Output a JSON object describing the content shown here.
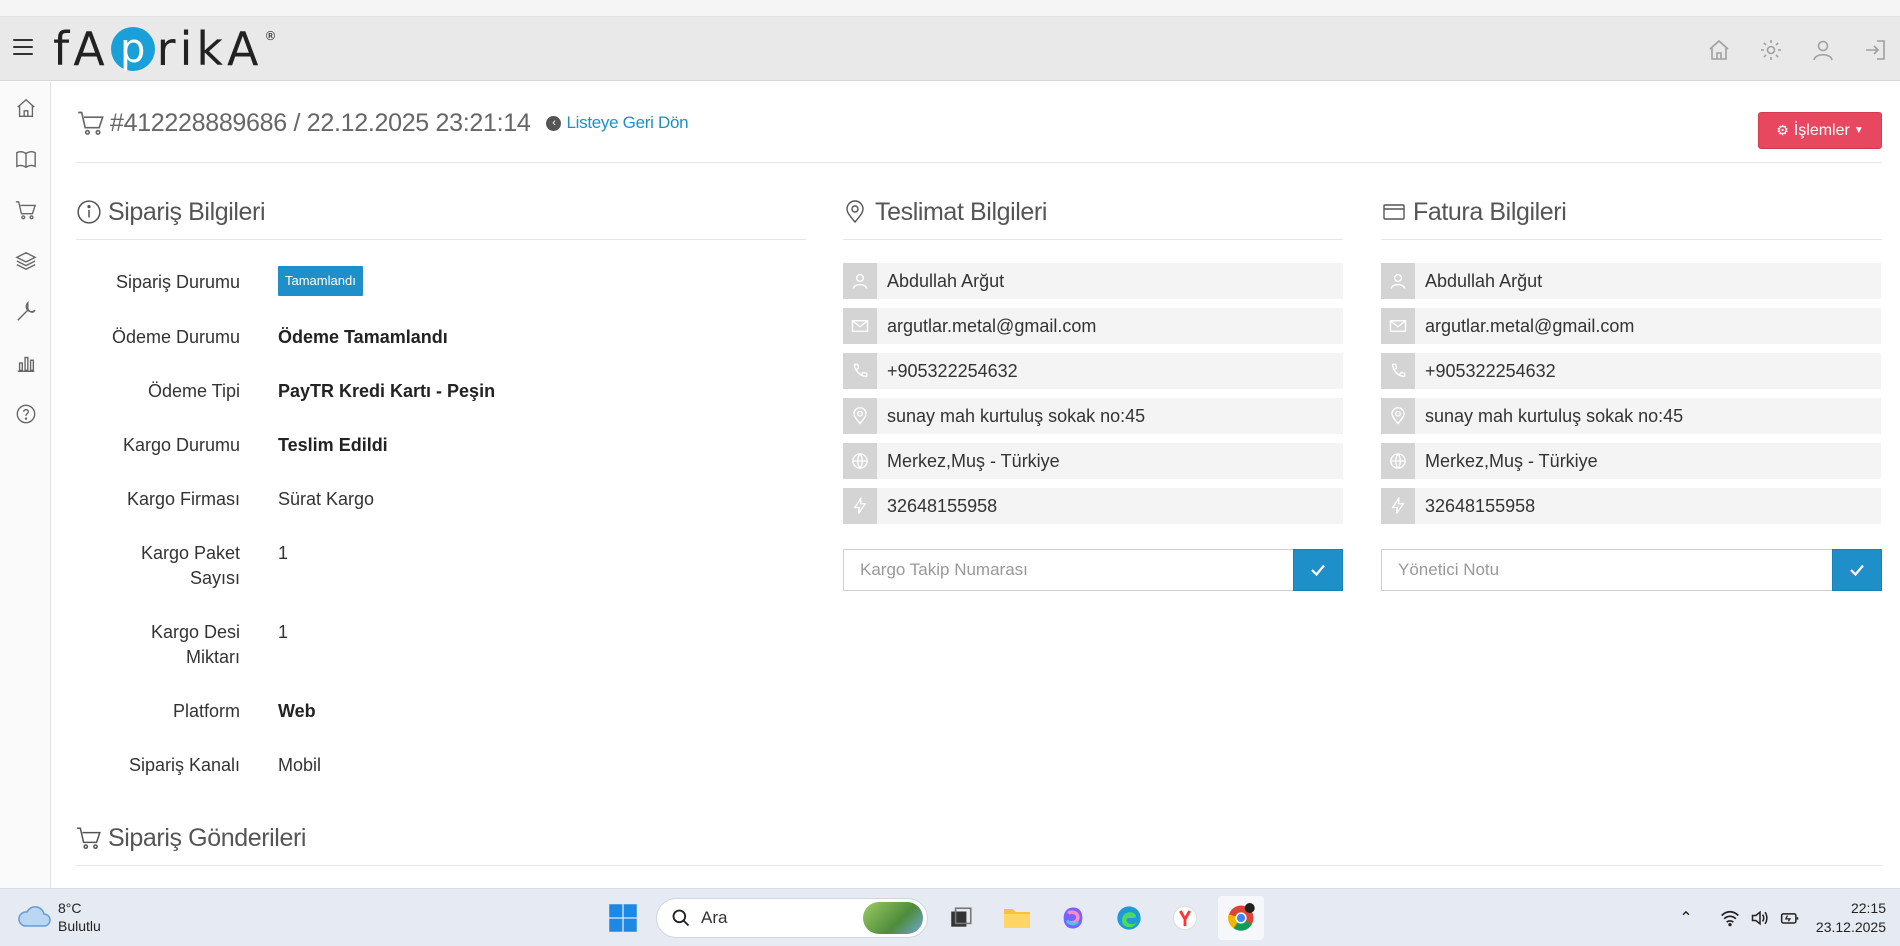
{
  "header": {
    "logo_left": "fA",
    "logo_p": "p",
    "logo_right": "rikA",
    "logo_reg": "®",
    "icons": [
      "home-icon",
      "gear-icon",
      "user-icon",
      "logout-icon"
    ]
  },
  "sidebar": {
    "icons": [
      "home-icon",
      "book-icon",
      "cart-icon",
      "layers-icon",
      "wrench-icon",
      "bar-chart-icon",
      "help-icon"
    ]
  },
  "order": {
    "title": "#412228889686 / 22.12.2025 23:21:14",
    "back_label": "Listeye Geri Dön",
    "actions_label": "İşlemler"
  },
  "order_info": {
    "title": "Sipariş Bilgileri",
    "rows": [
      {
        "label": "Sipariş Durumu",
        "value": "Tamamlandı"
      },
      {
        "label": "Ödeme Durumu",
        "value": "Ödeme Tamamlandı"
      },
      {
        "label": "Ödeme Tipi",
        "value": "PayTR Kredi Kartı - Peşin"
      },
      {
        "label": "Kargo Durumu",
        "value": "Teslim Edildi"
      },
      {
        "label": "Kargo Firması",
        "value": "Sürat Kargo"
      },
      {
        "label_line1": "Kargo Paket",
        "label_line2": "Sayısı",
        "value": "1"
      },
      {
        "label_line1": "Kargo Desi",
        "label_line2": "Miktarı",
        "value": "1"
      },
      {
        "label": "Platform",
        "value": "Web"
      },
      {
        "label": "Sipariş Kanalı",
        "value": "Mobil"
      }
    ]
  },
  "delivery": {
    "title": "Teslimat Bilgileri",
    "name": "Abdullah Arğut",
    "email": "argutlar.metal@gmail.com",
    "phone": "+905322254632",
    "address": "sunay mah kurtuluş sokak no:45",
    "region": "Merkez,Muş - Türkiye",
    "tax_no": "32648155958",
    "tracking_placeholder": "Kargo Takip Numarası"
  },
  "invoice": {
    "title": "Fatura Bilgileri",
    "name": "Abdullah Arğut",
    "email": "argutlar.metal@gmail.com",
    "phone": "+905322254632",
    "address": "sunay mah kurtuluş sokak no:45",
    "region": "Merkez,Muş - Türkiye",
    "tax_no": "32648155958",
    "note_placeholder": "Yönetici Notu"
  },
  "shipments": {
    "title": "Sipariş Gönderileri"
  },
  "taskbar": {
    "temperature": "8°C",
    "weather": "Bulutlu",
    "search_label": "Ara",
    "time": "22:15",
    "date": "23.12.2025"
  },
  "colors": {
    "accent": "#1e8fc9",
    "actions_button": "#e8485f",
    "logo_circle": "#1aa0d8"
  }
}
